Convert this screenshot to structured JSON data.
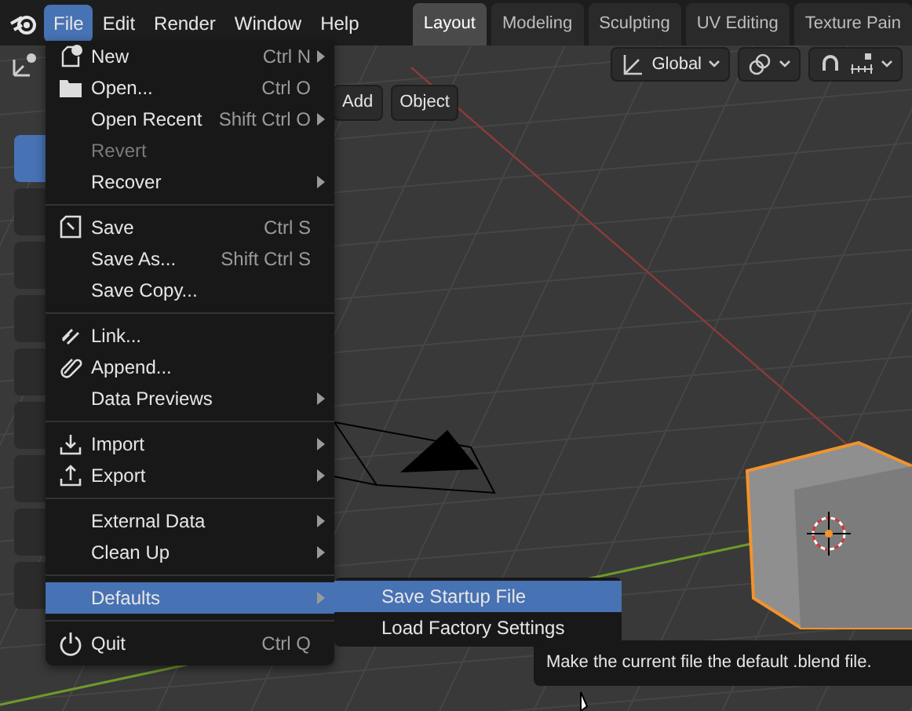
{
  "topbar": {
    "menus": [
      {
        "label": "File",
        "selected": true
      },
      {
        "label": "Edit",
        "selected": false
      },
      {
        "label": "Render",
        "selected": false
      },
      {
        "label": "Window",
        "selected": false
      },
      {
        "label": "Help",
        "selected": false
      }
    ],
    "workspace_tabs": [
      {
        "label": "Layout",
        "selected": true
      },
      {
        "label": "Modeling",
        "selected": false
      },
      {
        "label": "Sculpting",
        "selected": false
      },
      {
        "label": "UV Editing",
        "selected": false
      },
      {
        "label": "Texture Pain",
        "selected": false
      }
    ]
  },
  "header": {
    "orientation": "Global"
  },
  "viewport_header": {
    "buttons": [
      "Add",
      "Object"
    ]
  },
  "file_menu": {
    "items": [
      {
        "kind": "item",
        "label": "New",
        "shortcut": "Ctrl N",
        "submenu": true,
        "disabled": false,
        "selected": false
      },
      {
        "kind": "item",
        "label": "Open...",
        "shortcut": "Ctrl O",
        "submenu": false,
        "disabled": false,
        "selected": false
      },
      {
        "kind": "item",
        "label": "Open Recent",
        "shortcut": "Shift Ctrl O",
        "submenu": true,
        "disabled": false,
        "selected": false
      },
      {
        "kind": "item",
        "label": "Revert",
        "submenu": false,
        "disabled": true,
        "selected": false
      },
      {
        "kind": "item",
        "label": "Recover",
        "submenu": true,
        "disabled": false,
        "selected": false
      },
      {
        "kind": "separator"
      },
      {
        "kind": "item",
        "label": "Save",
        "shortcut": "Ctrl S",
        "submenu": false,
        "disabled": false,
        "selected": false
      },
      {
        "kind": "item",
        "label": "Save As...",
        "shortcut": "Shift Ctrl S",
        "submenu": false,
        "disabled": false,
        "selected": false
      },
      {
        "kind": "item",
        "label": "Save Copy...",
        "submenu": false,
        "disabled": false,
        "selected": false
      },
      {
        "kind": "separator"
      },
      {
        "kind": "item",
        "label": "Link...",
        "submenu": false,
        "disabled": false,
        "selected": false
      },
      {
        "kind": "item",
        "label": "Append...",
        "submenu": false,
        "disabled": false,
        "selected": false
      },
      {
        "kind": "item",
        "label": "Data Previews",
        "submenu": true,
        "disabled": false,
        "selected": false
      },
      {
        "kind": "separator"
      },
      {
        "kind": "item",
        "label": "Import",
        "submenu": true,
        "disabled": false,
        "selected": false
      },
      {
        "kind": "item",
        "label": "Export",
        "submenu": true,
        "disabled": false,
        "selected": false
      },
      {
        "kind": "separator"
      },
      {
        "kind": "item",
        "label": "External Data",
        "submenu": true,
        "disabled": false,
        "selected": false
      },
      {
        "kind": "item",
        "label": "Clean Up",
        "submenu": true,
        "disabled": false,
        "selected": false
      },
      {
        "kind": "separator"
      },
      {
        "kind": "item",
        "label": "Defaults",
        "submenu": true,
        "disabled": false,
        "selected": true
      },
      {
        "kind": "separator"
      },
      {
        "kind": "item",
        "label": "Quit",
        "shortcut": "Ctrl Q",
        "submenu": false,
        "disabled": false,
        "selected": false
      }
    ]
  },
  "defaults_submenu": {
    "items": [
      {
        "label": "Save Startup File",
        "selected": true
      },
      {
        "label": "Load Factory Settings",
        "selected": false
      }
    ]
  },
  "tooltip": {
    "text": "Make the current file the default .blend file."
  }
}
